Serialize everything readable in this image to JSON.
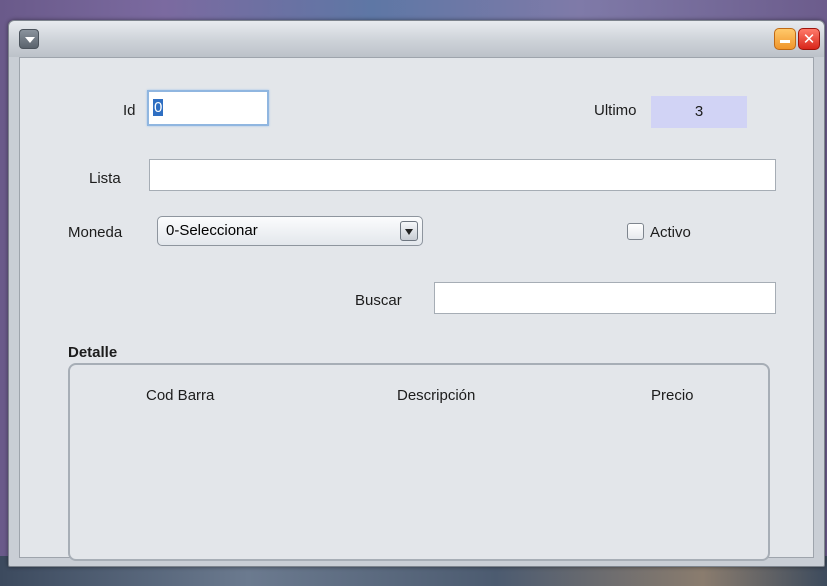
{
  "form": {
    "id_label": "Id",
    "id_value": "0",
    "ultimo_label": "Ultimo",
    "ultimo_value": "3",
    "lista_label": "Lista",
    "lista_value": "",
    "moneda_label": "Moneda",
    "moneda_selected": "0-Seleccionar",
    "activo_label": "Activo",
    "activo_checked": false,
    "buscar_label": "Buscar",
    "buscar_value": ""
  },
  "detalle": {
    "title": "Detalle",
    "columns": [
      "Cod Barra",
      "Descripción",
      "Precio"
    ],
    "rows": []
  },
  "colors": {
    "ultimo_bg": "#d1d3f5",
    "selection": "#2f6fc2",
    "minimize": "#f0952b",
    "close": "#d8261a"
  },
  "icons": {
    "window_menu": "chevron-down-icon",
    "minimize": "minimize-icon",
    "close": "close-icon",
    "combo_arrow": "dropdown-arrow-icon"
  }
}
